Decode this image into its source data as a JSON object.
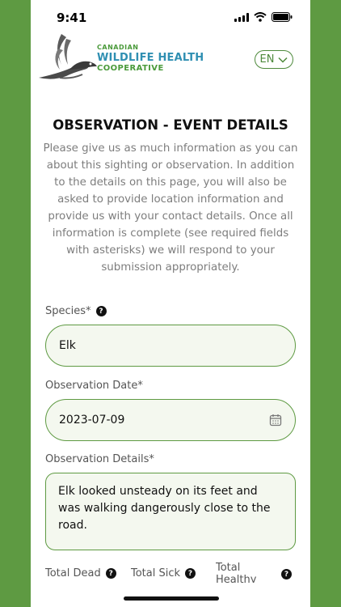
{
  "status_bar": {
    "time": "9:41"
  },
  "header": {
    "logo_line1": "CANADIAN",
    "logo_line2": "WILDLIFE HEALTH",
    "logo_line3": "COOPERATIVE",
    "language": "EN"
  },
  "page": {
    "title": "OBSERVATION - EVENT DETAILS",
    "intro": "Please give us as much information as you can about this sighting or observation. In addition to the details on this page, you will also be asked to provide location information and provide us with your contact details. Once all information is complete (see required fields with asterisks) we will respond to your submission appropriately."
  },
  "form": {
    "species": {
      "label": "Species*",
      "value": "Elk"
    },
    "observation_date": {
      "label": "Observation Date*",
      "value": "2023-07-09"
    },
    "observation_details": {
      "label": "Observation Details*",
      "value": "Elk looked unsteady on its feet and was walking dangerously close to the road."
    },
    "total_dead": {
      "label": "Total Dead"
    },
    "total_sick": {
      "label": "Total Sick"
    },
    "total_healthy": {
      "label_line1": "Total",
      "label_line2": "Healthy"
    },
    "help_glyph": "?"
  },
  "colors": {
    "accent": "#5e9a42",
    "field_bg": "#f4f8ef",
    "logo_blue": "#2f8fb2"
  }
}
